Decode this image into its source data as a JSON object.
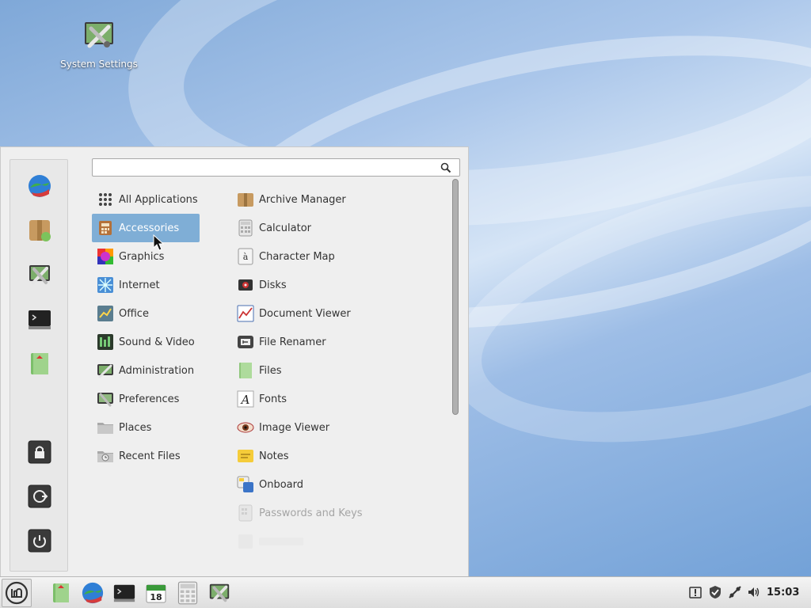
{
  "desktop": {
    "icons": [
      {
        "label": "System Settings",
        "icon": "settings-icon"
      }
    ]
  },
  "menu": {
    "search": {
      "value": "",
      "placeholder": ""
    },
    "favorites": [
      {
        "name": "web-browser",
        "icon": "globe-icon"
      },
      {
        "name": "software-manager",
        "icon": "package-icon"
      },
      {
        "name": "system-settings",
        "icon": "settings-icon"
      },
      {
        "name": "terminal",
        "icon": "terminal-icon"
      },
      {
        "name": "file-manager",
        "icon": "folder-icon"
      }
    ],
    "session": [
      {
        "name": "lock-screen",
        "icon": "lock-icon"
      },
      {
        "name": "logout",
        "icon": "logout-icon"
      },
      {
        "name": "shutdown",
        "icon": "power-icon"
      }
    ],
    "categories": [
      {
        "label": "All Applications",
        "icon": "grid-icon"
      },
      {
        "label": "Accessories",
        "icon": "accessories-icon",
        "selected": true
      },
      {
        "label": "Graphics",
        "icon": "graphics-icon"
      },
      {
        "label": "Internet",
        "icon": "internet-icon"
      },
      {
        "label": "Office",
        "icon": "office-icon"
      },
      {
        "label": "Sound & Video",
        "icon": "sound-video-icon"
      },
      {
        "label": "Administration",
        "icon": "administration-icon"
      },
      {
        "label": "Preferences",
        "icon": "preferences-icon"
      },
      {
        "label": "Places",
        "icon": "places-icon"
      },
      {
        "label": "Recent Files",
        "icon": "recent-files-icon"
      }
    ],
    "applications": [
      {
        "label": "Archive Manager",
        "icon": "archive-icon"
      },
      {
        "label": "Calculator",
        "icon": "calculator-icon"
      },
      {
        "label": "Character Map",
        "icon": "character-map-icon"
      },
      {
        "label": "Disks",
        "icon": "disks-icon"
      },
      {
        "label": "Document Viewer",
        "icon": "document-viewer-icon"
      },
      {
        "label": "File Renamer",
        "icon": "file-renamer-icon"
      },
      {
        "label": "Files",
        "icon": "files-icon"
      },
      {
        "label": "Fonts",
        "icon": "fonts-icon"
      },
      {
        "label": "Image Viewer",
        "icon": "image-viewer-icon"
      },
      {
        "label": "Notes",
        "icon": "notes-icon"
      },
      {
        "label": "Onboard",
        "icon": "onboard-icon"
      },
      {
        "label": "Passwords and Keys",
        "icon": "passwords-icon",
        "dimmed": true
      }
    ]
  },
  "taskbar": {
    "menu_button_icon": "mint-logo-icon",
    "launchers": [
      {
        "name": "file-manager",
        "icon": "folder-icon"
      },
      {
        "name": "web-browser",
        "icon": "globe-icon"
      },
      {
        "name": "terminal",
        "icon": "terminal-icon"
      },
      {
        "name": "calendar",
        "icon": "calendar-icon",
        "text": "18"
      },
      {
        "name": "calculator",
        "icon": "calculator-icon"
      },
      {
        "name": "system-settings",
        "icon": "settings-icon"
      }
    ],
    "tray": [
      {
        "name": "notifications",
        "icon": "notification-icon"
      },
      {
        "name": "update-manager",
        "icon": "shield-icon"
      },
      {
        "name": "network",
        "icon": "network-icon"
      },
      {
        "name": "volume",
        "icon": "volume-icon"
      }
    ],
    "clock": "15:03"
  },
  "colors": {
    "selection": "#7faed6",
    "menu_background": "#efefef",
    "taskbar_background": "#e6e6e6"
  }
}
